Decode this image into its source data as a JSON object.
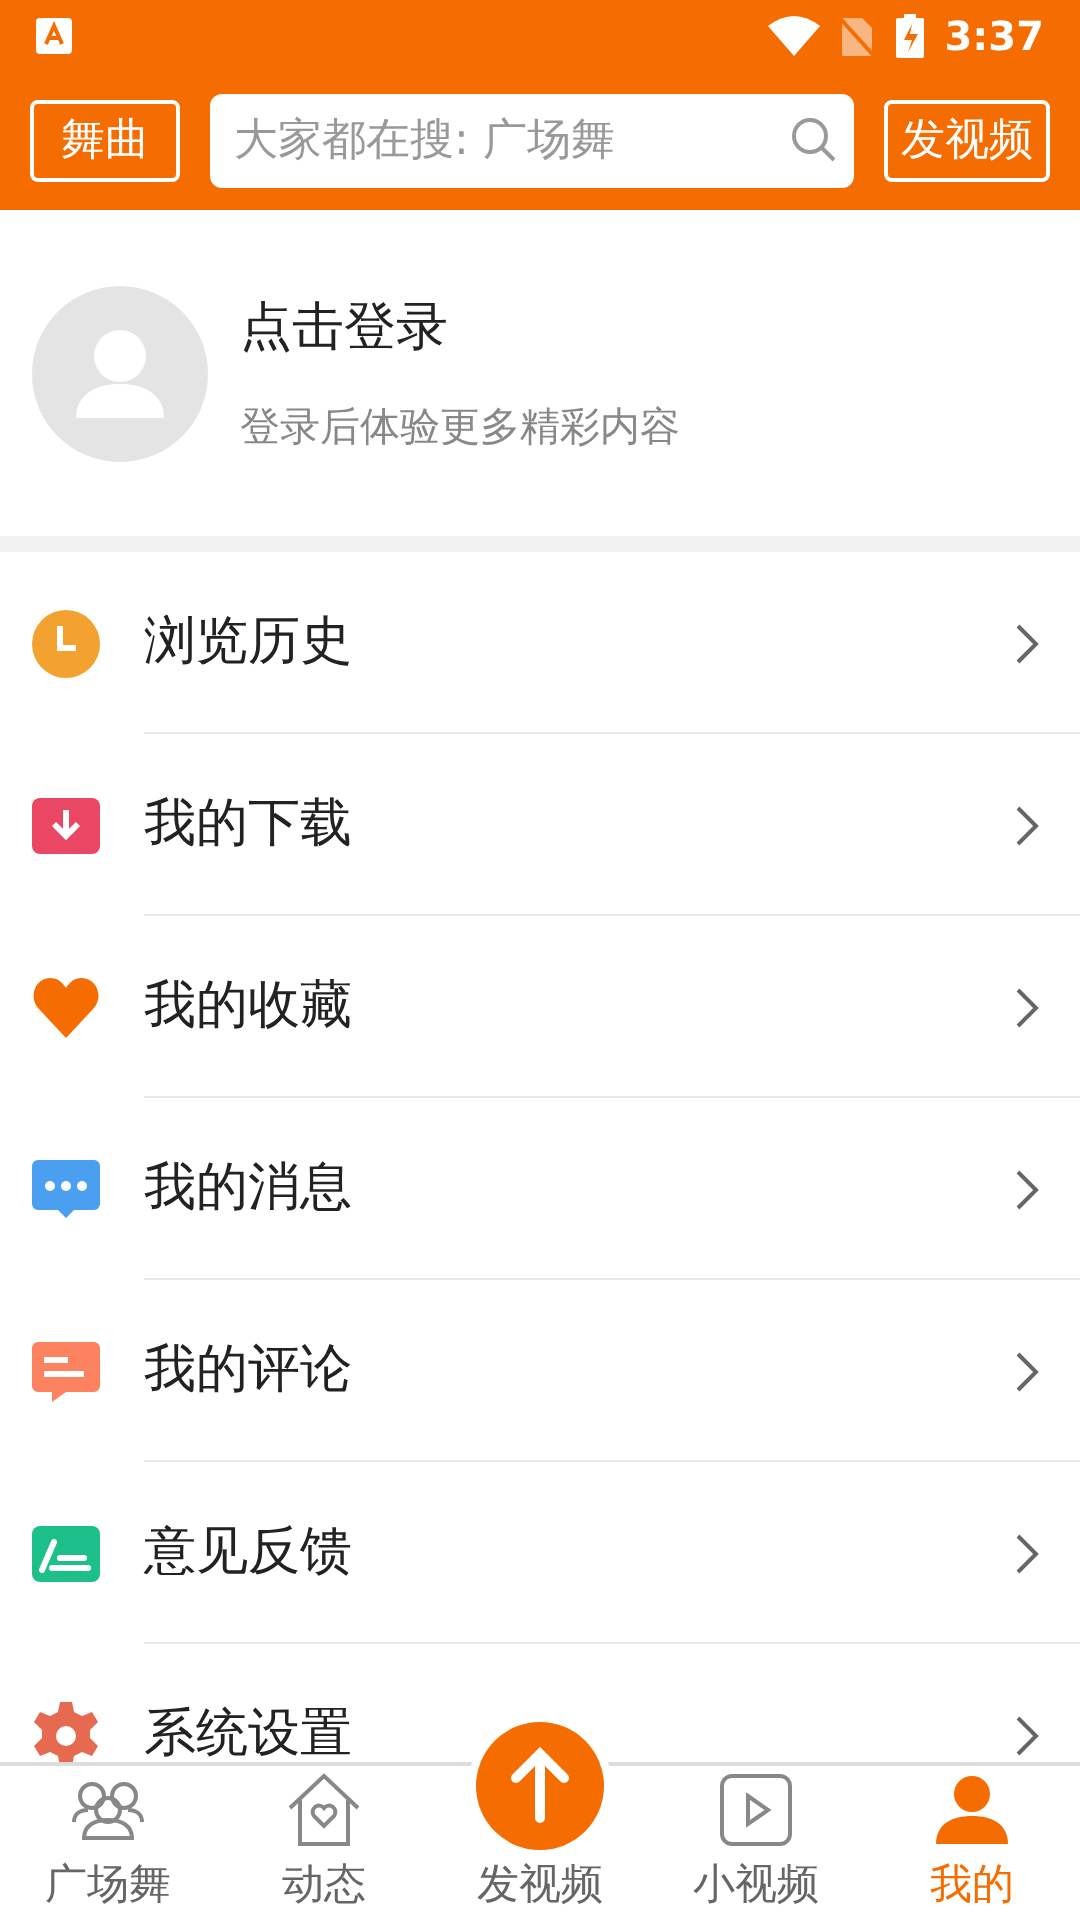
{
  "status_bar": {
    "time": "3:37"
  },
  "header": {
    "left_button": "舞曲",
    "search": {
      "placeholder": "大家都在搜: 广场舞"
    },
    "right_button": "发视频"
  },
  "profile": {
    "title": "点击登录",
    "subtitle": "登录后体验更多精彩内容"
  },
  "menu": [
    {
      "label": "浏览历史",
      "kind": "clock",
      "color": "#f3a12f"
    },
    {
      "label": "我的下载",
      "kind": "download",
      "color": "#e94763"
    },
    {
      "label": "我的收藏",
      "kind": "heart",
      "color": "#f56c00"
    },
    {
      "label": "我的消息",
      "kind": "message",
      "color": "#4a9ff0"
    },
    {
      "label": "我的评论",
      "kind": "comment",
      "color": "#fd8260"
    },
    {
      "label": "意见反馈",
      "kind": "feedback",
      "color": "#1dbf8a"
    },
    {
      "label": "系统设置",
      "kind": "settings",
      "color": "#e66a50"
    }
  ],
  "bottom_nav": [
    {
      "label": "广场舞",
      "kind": "people",
      "selected": false
    },
    {
      "label": "动态",
      "kind": "home",
      "selected": false
    },
    {
      "label": "发视频",
      "kind": "upload",
      "selected": false
    },
    {
      "label": "小视频",
      "kind": "play",
      "selected": false
    },
    {
      "label": "我的",
      "kind": "person",
      "selected": true
    }
  ]
}
